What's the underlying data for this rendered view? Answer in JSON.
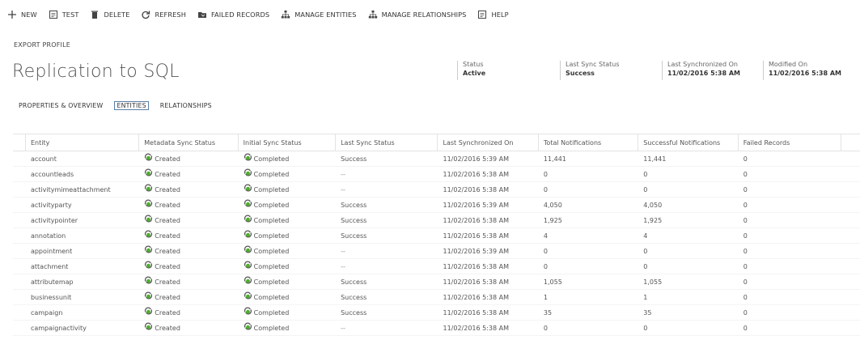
{
  "toolbar": {
    "items": [
      {
        "name": "new-button",
        "icon": "plus-icon",
        "label": "NEW"
      },
      {
        "name": "test-button",
        "icon": "test-icon",
        "label": "TEST"
      },
      {
        "name": "delete-button",
        "icon": "trash-icon",
        "label": "DELETE"
      },
      {
        "name": "refresh-button",
        "icon": "refresh-icon",
        "label": "REFRESH"
      },
      {
        "name": "failed-records-button",
        "icon": "folder-icon",
        "label": "FAILED RECORDS"
      },
      {
        "name": "manage-entities-button",
        "icon": "hierarchy-icon",
        "label": "MANAGE ENTITIES"
      },
      {
        "name": "manage-relationships-button",
        "icon": "hierarchy-icon",
        "label": "MANAGE RELATIONSHIPS"
      },
      {
        "name": "help-button",
        "icon": "help-icon",
        "label": "HELP"
      }
    ]
  },
  "record": {
    "type_label": "EXPORT PROFILE",
    "title": "Replication to SQL"
  },
  "header_fields": [
    {
      "label": "Status",
      "value": "Active"
    },
    {
      "label": "Last Sync Status",
      "value": "Success"
    },
    {
      "label": "Last Synchronized On",
      "value": "11/02/2016 5:38 AM"
    },
    {
      "label": "Modified On",
      "value": "11/02/2016 5:38 AM"
    }
  ],
  "tabs": [
    {
      "label": "PROPERTIES & OVERVIEW",
      "active": false
    },
    {
      "label": "ENTITIES",
      "active": true
    },
    {
      "label": "RELATIONSHIPS",
      "active": false
    }
  ],
  "grid": {
    "columns": [
      "Entity",
      "Metadata Sync Status",
      "Initial Sync Status",
      "Last Sync Status",
      "Last Synchronized On",
      "Total Notifications",
      "Successful Notifications",
      "Failed Records"
    ],
    "status_icon": "green-sync-icon",
    "rows": [
      [
        "account",
        "Created",
        "Completed",
        "Success",
        "11/02/2016 5:39 AM",
        "11,441",
        "11,441",
        "0"
      ],
      [
        "accountleads",
        "Created",
        "Completed",
        "--",
        "11/02/2016 5:38 AM",
        "0",
        "0",
        "0"
      ],
      [
        "activitymimeattachment",
        "Created",
        "Completed",
        "--",
        "11/02/2016 5:38 AM",
        "0",
        "0",
        "0"
      ],
      [
        "activityparty",
        "Created",
        "Completed",
        "Success",
        "11/02/2016 5:39 AM",
        "4,050",
        "4,050",
        "0"
      ],
      [
        "activitypointer",
        "Created",
        "Completed",
        "Success",
        "11/02/2016 5:38 AM",
        "1,925",
        "1,925",
        "0"
      ],
      [
        "annotation",
        "Created",
        "Completed",
        "Success",
        "11/02/2016 5:38 AM",
        "4",
        "4",
        "0"
      ],
      [
        "appointment",
        "Created",
        "Completed",
        "--",
        "11/02/2016 5:39 AM",
        "0",
        "0",
        "0"
      ],
      [
        "attachment",
        "Created",
        "Completed",
        "--",
        "11/02/2016 5:38 AM",
        "0",
        "0",
        "0"
      ],
      [
        "attributemap",
        "Created",
        "Completed",
        "Success",
        "11/02/2016 5:38 AM",
        "1,055",
        "1,055",
        "0"
      ],
      [
        "businessunit",
        "Created",
        "Completed",
        "Success",
        "11/02/2016 5:38 AM",
        "1",
        "1",
        "0"
      ],
      [
        "campaign",
        "Created",
        "Completed",
        "Success",
        "11/02/2016 5:38 AM",
        "35",
        "35",
        "0"
      ],
      [
        "campaignactivity",
        "Created",
        "Completed",
        "--",
        "11/02/2016 5:38 AM",
        "0",
        "0",
        "0"
      ]
    ]
  }
}
